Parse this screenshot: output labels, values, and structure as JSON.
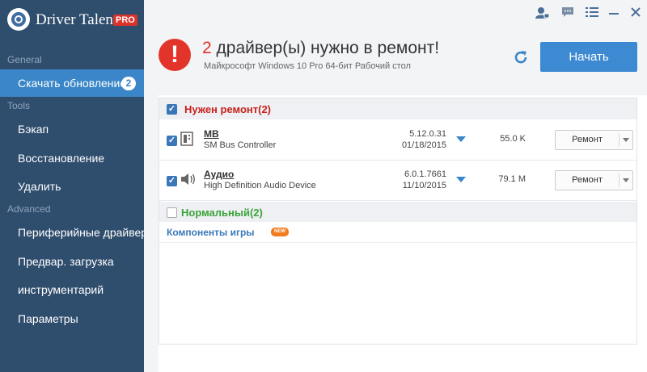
{
  "app": {
    "name": "Driver Talent",
    "edition": "PRO"
  },
  "sidebar": {
    "sections": [
      {
        "label": "General"
      },
      {
        "label": "Tools"
      },
      {
        "label": "Advanced"
      }
    ],
    "items": [
      {
        "label": "Скачать обновление",
        "badge": "2",
        "active": true
      },
      {
        "label": "Бэкап"
      },
      {
        "label": "Восстановление"
      },
      {
        "label": "Удалить"
      },
      {
        "label": "Периферийные драйвера"
      },
      {
        "label": "Предвар. загрузка"
      },
      {
        "label": "инструментарий"
      },
      {
        "label": "Параметры"
      }
    ]
  },
  "header": {
    "count": "2",
    "title_rest": " драйвер(ы) нужно в ремонт!",
    "subtitle": "Майкрософт Windows 10 Pro 64-бит Рабочий стол",
    "start_label": "Начать"
  },
  "groups": {
    "repair": {
      "title": "Нужен ремонт(2)",
      "color": "#c8201a"
    },
    "normal": {
      "title": "Нормальный(2)",
      "color": "#3aa33a"
    },
    "games": {
      "title": "Компоненты игры",
      "badge": "NEW"
    }
  },
  "drivers": [
    {
      "name": "MB",
      "description": "SM Bus Controller",
      "version": "5.12.0.31",
      "date": "01/18/2015",
      "size": "55.0 K",
      "action": "Ремонт",
      "icon": "chip-icon"
    },
    {
      "name": "Аудио",
      "description": "High Definition Audio Device",
      "version": "6.0.1.7661",
      "date": "11/10/2015",
      "size": "79.1 M",
      "action": "Ремонт",
      "icon": "speaker-icon"
    }
  ],
  "colors": {
    "sidebar": "#2f4d6d",
    "accent": "#3a86c8",
    "alert": "#e2342b"
  }
}
